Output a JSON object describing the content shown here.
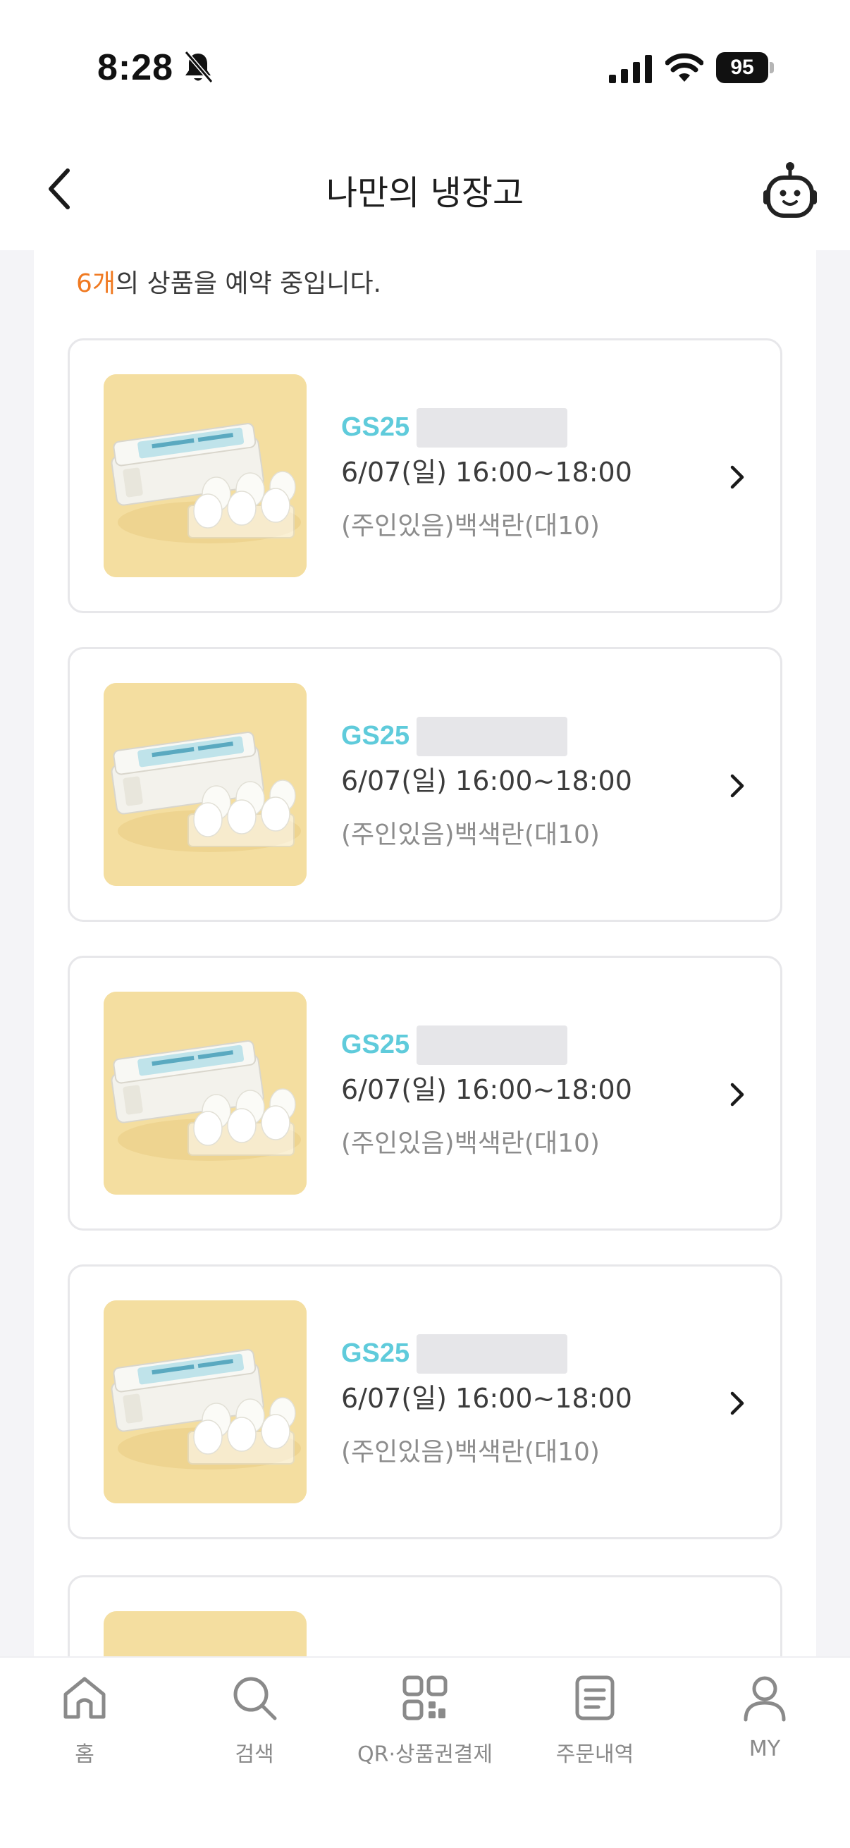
{
  "status": {
    "time": "8:28",
    "battery": "95"
  },
  "header": {
    "title": "나만의 냉장고"
  },
  "summary": {
    "count": "6개",
    "text": "의 상품을 예약 중입니다."
  },
  "reservations": [
    {
      "store": "GS25",
      "datetime": "6/07(일) 16:00~18:00",
      "product": "(주인있음)백색란(대10)"
    },
    {
      "store": "GS25",
      "datetime": "6/07(일) 16:00~18:00",
      "product": "(주인있음)백색란(대10)"
    },
    {
      "store": "GS25",
      "datetime": "6/07(일) 16:00~18:00",
      "product": "(주인있음)백색란(대10)"
    },
    {
      "store": "GS25",
      "datetime": "6/07(일) 16:00~18:00",
      "product": "(주인있음)백색란(대10)"
    }
  ],
  "bottom_nav": [
    {
      "label": "홈",
      "icon": "home-icon"
    },
    {
      "label": "검색",
      "icon": "search-icon"
    },
    {
      "label": "QR·상품권결제",
      "icon": "qr-icon"
    },
    {
      "label": "주문내역",
      "icon": "order-history-icon"
    },
    {
      "label": "MY",
      "icon": "user-icon"
    }
  ],
  "colors": {
    "accent_orange": "#f07a22",
    "store_teal": "#5fcbdb",
    "thumbnail_bg": "#f4dea0"
  }
}
